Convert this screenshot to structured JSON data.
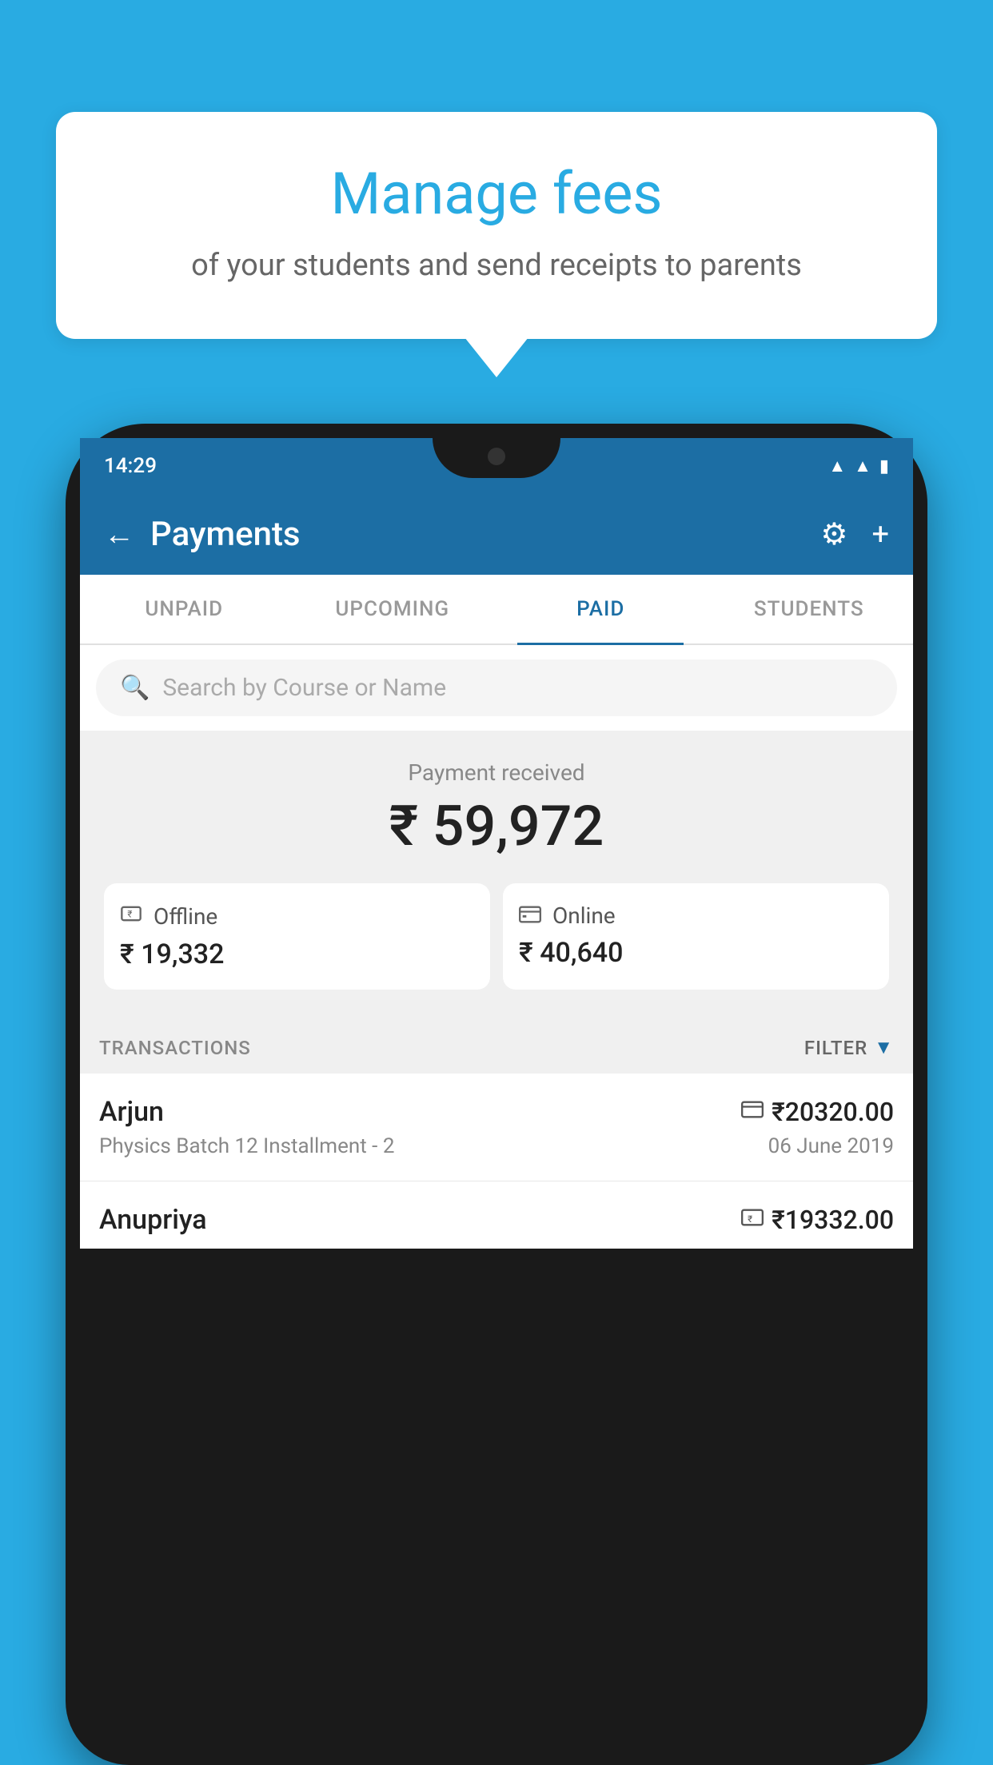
{
  "background_color": "#29ABE2",
  "tooltip": {
    "title": "Manage fees",
    "subtitle": "of your students and send receipts to parents"
  },
  "status_bar": {
    "time": "14:29",
    "icons": [
      "wifi",
      "signal",
      "battery"
    ]
  },
  "header": {
    "title": "Payments",
    "back_label": "←",
    "settings_icon": "gear",
    "add_icon": "+"
  },
  "tabs": [
    {
      "label": "UNPAID",
      "active": false
    },
    {
      "label": "UPCOMING",
      "active": false
    },
    {
      "label": "PAID",
      "active": true
    },
    {
      "label": "STUDENTS",
      "active": false
    }
  ],
  "search": {
    "placeholder": "Search by Course or Name"
  },
  "payment_received": {
    "label": "Payment received",
    "amount": "₹ 59,972",
    "offline": {
      "label": "Offline",
      "amount": "₹ 19,332",
      "icon": "rupee-card"
    },
    "online": {
      "label": "Online",
      "amount": "₹ 40,640",
      "icon": "credit-card"
    }
  },
  "transactions": {
    "section_label": "TRANSACTIONS",
    "filter_label": "FILTER",
    "items": [
      {
        "name": "Arjun",
        "amount": "₹20320.00",
        "payment_type": "online",
        "description": "Physics Batch 12 Installment - 2",
        "date": "06 June 2019"
      },
      {
        "name": "Anupriya",
        "amount": "₹19332.00",
        "payment_type": "offline",
        "description": "",
        "date": ""
      }
    ]
  }
}
